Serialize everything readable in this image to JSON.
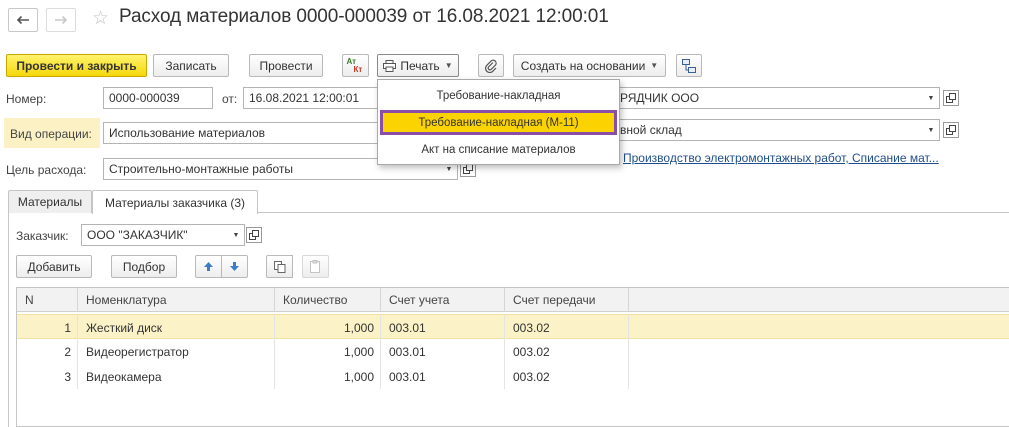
{
  "window": {
    "title": "Расход материалов 0000-000039 от 16.08.2021 12:00:01"
  },
  "toolbar": {
    "post_close": "Провести и закрыть",
    "save": "Записать",
    "post": "Провести",
    "print": "Печать",
    "create_based_on": "Создать на основании",
    "dtkt_top": "Ат",
    "dtkt_bottom": "Кт"
  },
  "print_menu": {
    "items": [
      "Требование-накладная",
      "Требование-накладная (М-11)",
      "Акт на списание материалов"
    ],
    "highlighted_index": 1
  },
  "form": {
    "number_label": "Номер:",
    "number_value": "0000-000039",
    "date_label": "от:",
    "date_value": "16.08.2021 12:00:01",
    "contractor_value": "РЯДЧИК ООО",
    "operation_label": "Вид операции:",
    "operation_value": "Использование материалов",
    "warehouse_value": "вной склад",
    "purpose_label": "Цель расхода:",
    "purpose_value": "Строительно-монтажные работы",
    "production_link": "Производство электромонтажных работ, Списание мат..."
  },
  "tabs": [
    {
      "label": "Материалы",
      "active": false
    },
    {
      "label": "Материалы заказчика (3)",
      "active": true
    }
  ],
  "customer": {
    "label": "Заказчик:",
    "value": "ООО \"ЗАКАЗЧИК\""
  },
  "table_toolbar": {
    "add": "Добавить",
    "pick": "Подбор"
  },
  "table": {
    "columns": [
      "N",
      "Номенклатура",
      "Количество",
      "Счет учета",
      "Счет передачи"
    ],
    "rows": [
      {
        "n": "1",
        "name": "Жесткий диск",
        "qty": "1,000",
        "account": "003.01",
        "transfer": "003.02",
        "selected": true
      },
      {
        "n": "2",
        "name": "Видеорегистратор",
        "qty": "1,000",
        "account": "003.01",
        "transfer": "003.02",
        "selected": false
      },
      {
        "n": "3",
        "name": "Видеокамера",
        "qty": "1,000",
        "account": "003.01",
        "transfer": "003.02",
        "selected": false
      }
    ]
  },
  "colors": {
    "primary_button": "#f5d80a",
    "highlight_border": "#8b4ea6",
    "highlight_fill": "#fbd300",
    "selected_row": "#fbf2c7",
    "operation_label_bg": "#fbf1c5",
    "link": "#1f4e8c"
  }
}
